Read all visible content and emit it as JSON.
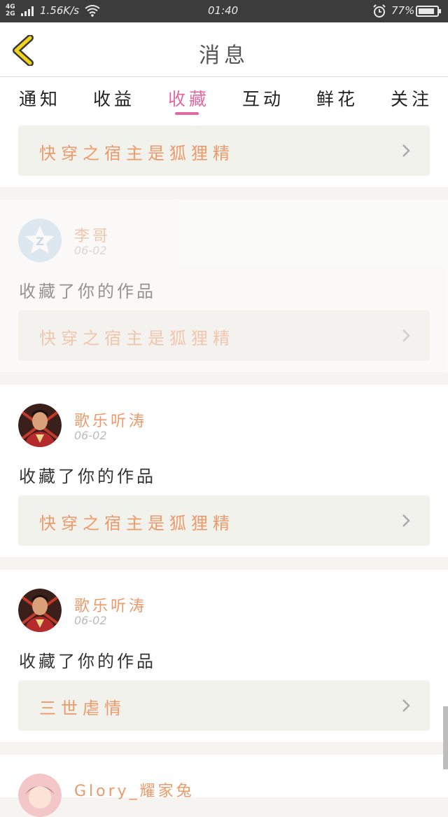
{
  "status_bar": {
    "network": "4G\n2G",
    "speed": "1.56K/s",
    "time": "01:40",
    "battery": "77%",
    "icons": [
      "signal-icon",
      "wifi-icon",
      "alarm-icon",
      "battery-icon"
    ]
  },
  "header": {
    "title": "消息",
    "back_icon": "chevron-left-icon",
    "accent": "#f2d21b"
  },
  "tabs": [
    {
      "label": "通知",
      "active": false
    },
    {
      "label": "收益",
      "active": false
    },
    {
      "label": "收藏",
      "active": true
    },
    {
      "label": "互动",
      "active": false
    },
    {
      "label": "鲜花",
      "active": false
    },
    {
      "label": "关注",
      "active": false
    }
  ],
  "colors": {
    "tab_active": "#e06aa4",
    "name_orange": "#ec9a6b",
    "work_bg": "#f2f2ec"
  },
  "first_work_title": "快穿之宿主是狐狸精",
  "items": [
    {
      "user": "李哥",
      "date": "06-02",
      "action": "收藏了你的作品",
      "work": "快穿之宿主是狐狸精",
      "avatar": "default-avatar-icon"
    },
    {
      "user": "歌乐听涛",
      "date": "06-02",
      "action": "收藏了你的作品",
      "work": "快穿之宿主是狐狸精",
      "avatar": "user-avatar"
    },
    {
      "user": "歌乐听涛",
      "date": "06-02",
      "action": "收藏了你的作品",
      "work": "三世虐情",
      "avatar": "user-avatar"
    },
    {
      "user": "Glory_耀家兔",
      "date": "",
      "action": "",
      "work": "",
      "avatar": "user-avatar"
    }
  ]
}
